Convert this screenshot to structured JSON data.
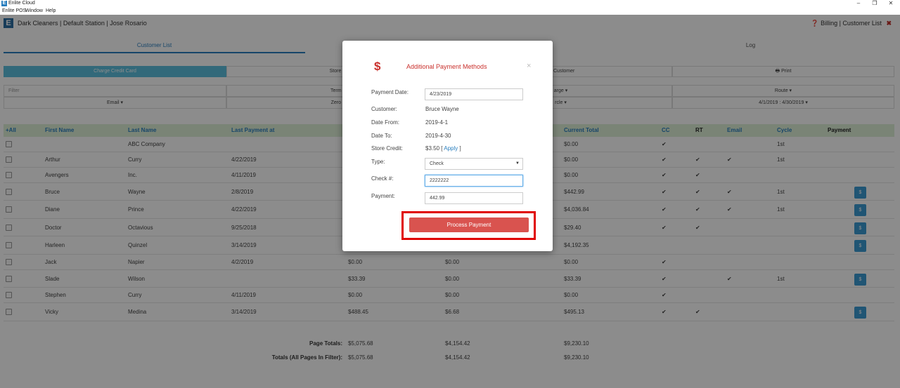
{
  "os": {
    "window_title": "Enlite Cloud",
    "menu": [
      "Enlite POS",
      "Window",
      "Help"
    ],
    "controls": [
      "–",
      "❐",
      "✕"
    ]
  },
  "header": {
    "title": "Dark Cleaners | Default Station | Jose Rosario",
    "right": "Billing | Customer List",
    "logo_letter": "E"
  },
  "tabs": [
    {
      "label": "Customer List"
    },
    {
      "label": "Log"
    }
  ],
  "buttons": {
    "charge_credit_card": "Charge Credit Card",
    "store": "Store C",
    "save_customer": "ve Customer",
    "print": "Print"
  },
  "filters": {
    "row1": [
      "Filter",
      "Term",
      "arge",
      "Route"
    ],
    "row2": [
      "Email",
      "Zero",
      "rcle",
      "4/1/2019 : 4/30/2019"
    ]
  },
  "grid": {
    "headers": {
      "all": "+All",
      "first_name": "First Name",
      "last_name": "Last Name",
      "last_payment": "Last Payment at",
      "current_total": "Current Total",
      "cc": "CC",
      "rt": "RT",
      "email": "Email",
      "cycle": "Cycle",
      "payment": "Payment"
    },
    "rows": [
      {
        "first": "",
        "last": "ABC Company",
        "last_payment": "",
        "col_a": "",
        "col_b": "",
        "total": "$0.00",
        "cc": true,
        "rt": false,
        "email": false,
        "cycle": "1st",
        "pay": false
      },
      {
        "first": "Arthur",
        "last": "Curry",
        "last_payment": "4/22/2019",
        "col_a": "",
        "col_b": "",
        "total": "$0.00",
        "cc": true,
        "rt": true,
        "email": true,
        "cycle": "1st",
        "pay": false
      },
      {
        "first": "Avengers",
        "last": "Inc.",
        "last_payment": "4/11/2019",
        "col_a": "",
        "col_b": "",
        "total": "$0.00",
        "cc": true,
        "rt": true,
        "email": false,
        "cycle": "",
        "pay": false
      },
      {
        "first": "Bruce",
        "last": "Wayne",
        "last_payment": "2/8/2019",
        "col_a": "",
        "col_b": "",
        "total": "$442.99",
        "cc": true,
        "rt": true,
        "email": true,
        "cycle": "1st",
        "pay": true
      },
      {
        "first": "Diane",
        "last": "Prince",
        "last_payment": "4/22/2019",
        "col_a": "",
        "col_b": "",
        "total": "$4,036.84",
        "cc": true,
        "rt": true,
        "email": true,
        "cycle": "1st",
        "pay": true
      },
      {
        "first": "Doctor",
        "last": "Octavious",
        "last_payment": "9/25/2018",
        "col_a": "",
        "col_b": "",
        "total": "$29.40",
        "cc": true,
        "rt": true,
        "email": false,
        "cycle": "",
        "pay": true
      },
      {
        "first": "Harleen",
        "last": "Quinzel",
        "last_payment": "3/14/2019",
        "col_a": "$4,192.35",
        "col_b": "$0.00",
        "total": "$4,192.35",
        "cc": false,
        "rt": false,
        "email": false,
        "cycle": "",
        "pay": true
      },
      {
        "first": "Jack",
        "last": "Napier",
        "last_payment": "4/2/2019",
        "col_a": "$0.00",
        "col_b": "$0.00",
        "total": "$0.00",
        "cc": true,
        "rt": false,
        "email": false,
        "cycle": "",
        "pay": false
      },
      {
        "first": "Slade",
        "last": "Wilson",
        "last_payment": "",
        "col_a": "$33.39",
        "col_b": "$0.00",
        "total": "$33.39",
        "cc": true,
        "rt": false,
        "email": true,
        "cycle": "1st",
        "pay": true
      },
      {
        "first": "Stephen",
        "last": "Curry",
        "last_payment": "4/11/2019",
        "col_a": "$0.00",
        "col_b": "$0.00",
        "total": "$0.00",
        "cc": true,
        "rt": false,
        "email": false,
        "cycle": "",
        "pay": false
      },
      {
        "first": "Vicky",
        "last": "Medina",
        "last_payment": "3/14/2019",
        "col_a": "$488.45",
        "col_b": "$6.68",
        "total": "$495.13",
        "cc": true,
        "rt": true,
        "email": false,
        "cycle": "",
        "pay": true
      }
    ],
    "pay_button_label": "$",
    "check_mark": "✔",
    "totals": {
      "page_label": "Page Totals:",
      "page_a": "$5,075.68",
      "page_b": "$4,154.42",
      "page_total": "$9,230.10",
      "all_label": "Totals (All Pages In Filter):",
      "all_a": "$5,075.68",
      "all_b": "$4,154.42",
      "all_total": "$9,230.10"
    }
  },
  "modal": {
    "icon": "$",
    "title": "Additional Payment Methods",
    "close": "×",
    "payment_date_label": "Payment Date:",
    "payment_date_value": "4/23/2019",
    "customer_label": "Customer:",
    "customer_value": "Bruce Wayne",
    "date_from_label": "Date From:",
    "date_from_value": "2019-4-1",
    "date_to_label": "Date To:",
    "date_to_value": "2019-4-30",
    "store_credit_label": "Store Credit:",
    "store_credit_value": "$3.50 [",
    "store_credit_apply": "Apply",
    "store_credit_end": "]",
    "type_label": "Type:",
    "type_value": "Check",
    "check_label": "Check #:",
    "check_value": "2222222",
    "payment_label": "Payment:",
    "payment_value": "442.99",
    "process_button": "Process Payment"
  },
  "colors": {
    "accent": "#2a7fbf",
    "danger": "#d9534f",
    "highlight_box": "#e00000",
    "grid_header": "#dff0d8"
  }
}
